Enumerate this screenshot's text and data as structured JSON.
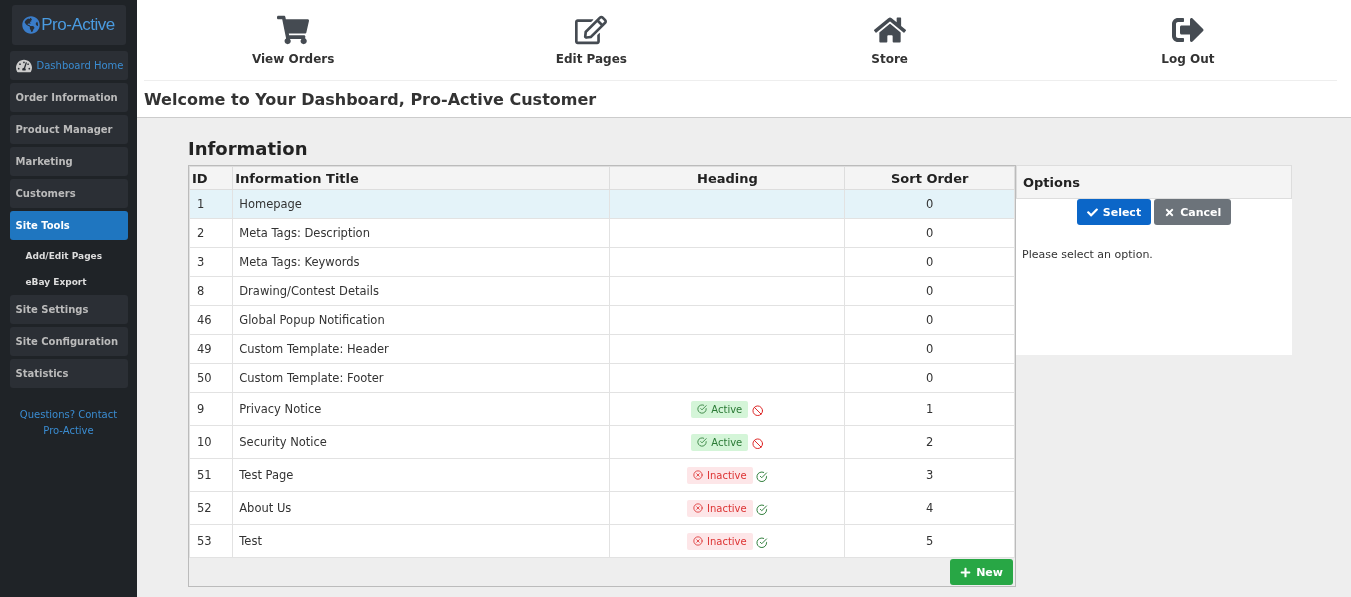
{
  "sidebar": {
    "logo": "Pro-Active",
    "items": [
      {
        "label": "Dashboard Home",
        "kind": "home",
        "selected": false
      },
      {
        "label": "Order Information",
        "kind": "section",
        "selected": false
      },
      {
        "label": "Product Manager",
        "kind": "section",
        "selected": false
      },
      {
        "label": "Marketing",
        "kind": "section",
        "selected": false
      },
      {
        "label": "Customers",
        "kind": "section",
        "selected": false
      },
      {
        "label": "Site Tools",
        "kind": "section",
        "selected": true
      },
      {
        "label": "Add/Edit Pages",
        "kind": "sub",
        "selected": false
      },
      {
        "label": "eBay Export",
        "kind": "sub",
        "selected": false
      },
      {
        "label": "Site Settings",
        "kind": "section",
        "selected": false
      },
      {
        "label": "Site Configuration",
        "kind": "section",
        "selected": false
      },
      {
        "label": "Statistics",
        "kind": "section",
        "selected": false
      }
    ],
    "help_link": "Questions? Contact Pro-Active"
  },
  "toolbar": [
    {
      "label": "View Orders",
      "kind": "cart"
    },
    {
      "label": "Edit Pages",
      "kind": "edit"
    },
    {
      "label": "Store",
      "kind": "home"
    },
    {
      "label": "Log Out",
      "kind": "logout"
    }
  ],
  "welcome": "Welcome to Your Dashboard, Pro-Active Customer",
  "table": {
    "title": "Information",
    "columns": [
      "ID",
      "Information Title",
      "Heading",
      "Sort Order"
    ],
    "rows": [
      {
        "id": "1",
        "title": "Homepage",
        "kind": "plain",
        "sort": "0",
        "selected": true
      },
      {
        "id": "2",
        "title": "Meta Tags: Description",
        "kind": "plain",
        "sort": "0",
        "selected": false
      },
      {
        "id": "3",
        "title": "Meta Tags: Keywords",
        "kind": "plain",
        "sort": "0",
        "selected": false
      },
      {
        "id": "8",
        "title": "Drawing/Contest Details",
        "kind": "plain",
        "sort": "0",
        "selected": false
      },
      {
        "id": "46",
        "title": "Global Popup Notification",
        "kind": "plain",
        "sort": "0",
        "selected": false
      },
      {
        "id": "49",
        "title": "Custom Template: Header",
        "kind": "plain",
        "sort": "0",
        "selected": false
      },
      {
        "id": "50",
        "title": "Custom Template: Footer",
        "kind": "plain",
        "sort": "0",
        "selected": false
      },
      {
        "id": "9",
        "title": "Privacy Notice",
        "kind": "active",
        "badge": "Active",
        "sort": "1",
        "selected": false
      },
      {
        "id": "10",
        "title": "Security Notice",
        "kind": "active",
        "badge": "Active",
        "sort": "2",
        "selected": false
      },
      {
        "id": "51",
        "title": "Test Page",
        "kind": "inactive",
        "badge": "Inactive",
        "sort": "3",
        "selected": false
      },
      {
        "id": "52",
        "title": "About Us",
        "kind": "inactive",
        "badge": "Inactive",
        "sort": "4",
        "selected": false
      },
      {
        "id": "53",
        "title": "Test",
        "kind": "inactive",
        "badge": "Inactive",
        "sort": "5",
        "selected": false
      }
    ],
    "new_button": "New"
  },
  "options": {
    "title": "Options",
    "select_button": "Select",
    "cancel_button": "Cancel",
    "message": "Please select an option."
  }
}
